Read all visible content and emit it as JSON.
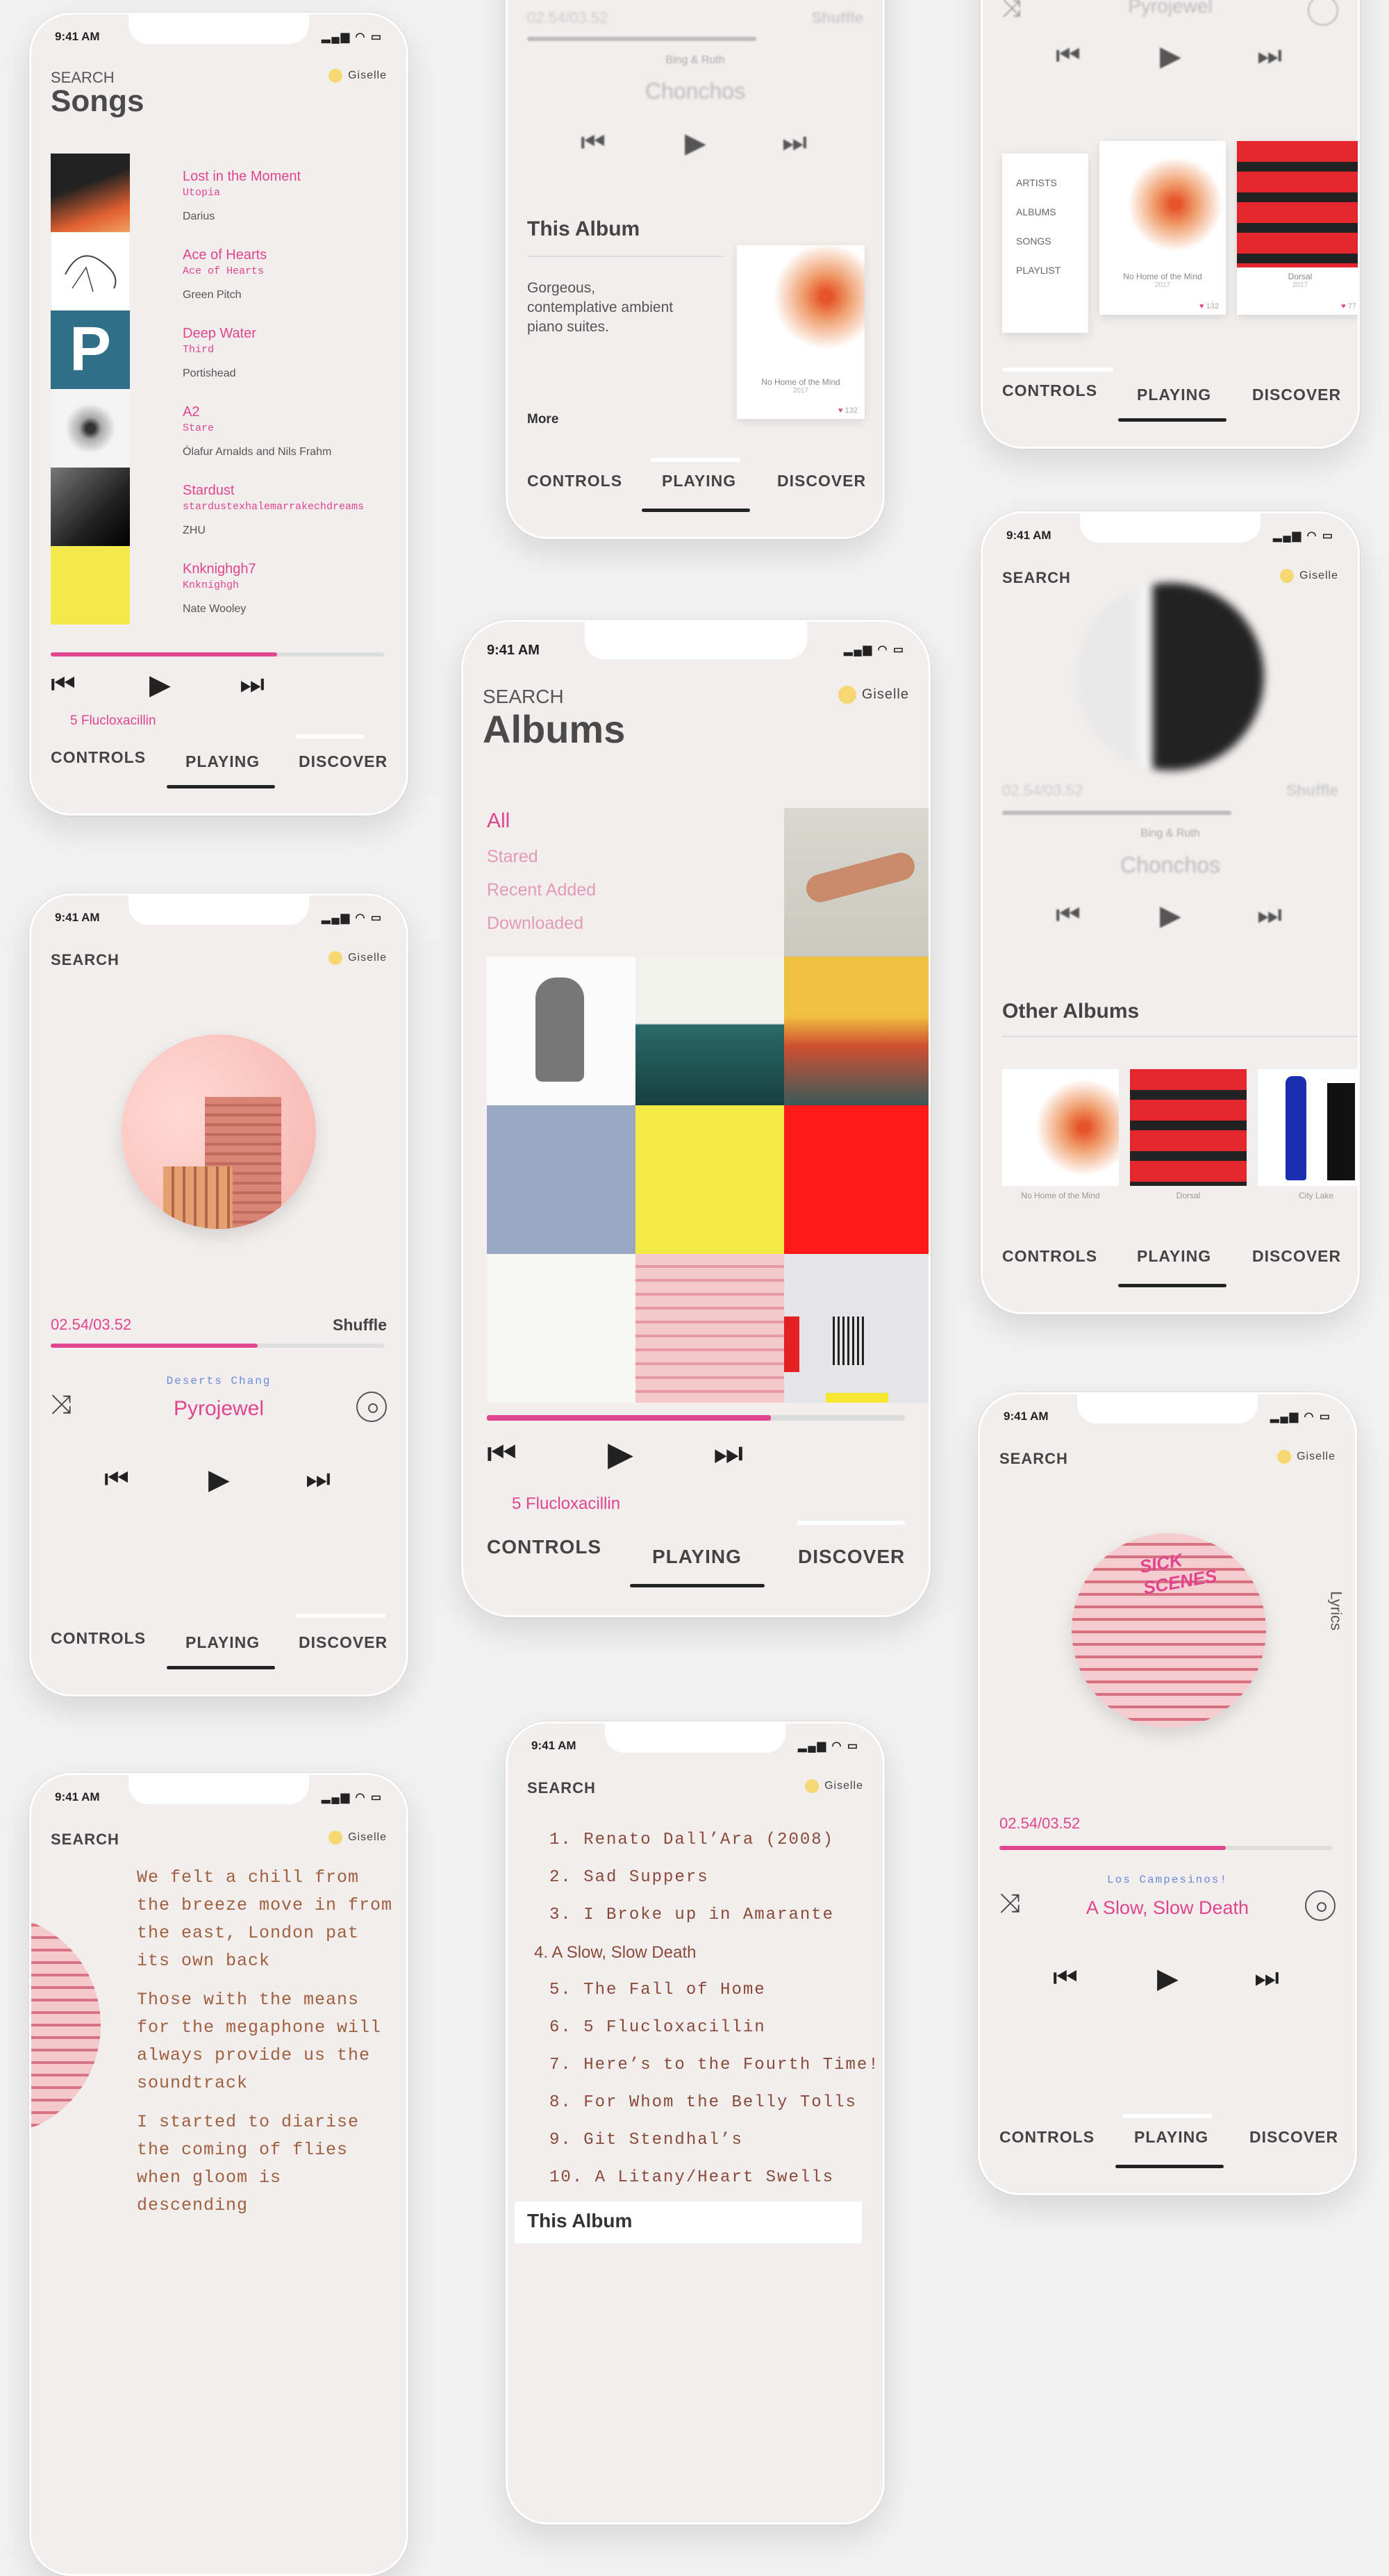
{
  "status": {
    "time": "9:41 AM",
    "signal": "▂▄▆ ◠ ▭"
  },
  "user": {
    "name": "Giselle"
  },
  "common": {
    "search": "SEARCH",
    "tabs": [
      "CONTROLS",
      "PLAYING",
      "DISCOVER"
    ]
  },
  "songs_screen": {
    "title": "Songs",
    "songs": [
      {
        "title": "Lost in the Moment",
        "album": "Utopia",
        "artist": "Darius"
      },
      {
        "title": "Ace of Hearts",
        "album": "Ace of Hearts",
        "artist": "Green Pitch"
      },
      {
        "title": "Deep Water",
        "album": "Third",
        "artist": "Portishead"
      },
      {
        "title": "A2",
        "album": "Stare",
        "artist": "Ólafur Arnalds and Nils Frahm"
      },
      {
        "title": "Stardust",
        "album": "stardustexhalemarrakechdreams",
        "artist": "ZHU"
      },
      {
        "title": "Knknighgh7",
        "album": "Knknighgh",
        "artist": "Nate Wooley"
      }
    ],
    "now_playing": "5 Flucloxacillin",
    "progress": 0.68
  },
  "album_detail": {
    "time": "02.54/03.52",
    "shuffle": "Shuffle",
    "artist": "Bing & Ruth",
    "song": "Chonchos",
    "section": "This Album",
    "description": "Gorgeous, contemplative ambient piano suites.",
    "more": "More",
    "album_name": "No Home of the Mind",
    "album_year": "2017",
    "likes": "132"
  },
  "menu_screen": {
    "song": "Pyrojewel",
    "menu": [
      "ARTISTS",
      "ALBUMS",
      "SONGS",
      "PLAYLIST"
    ],
    "cards": [
      {
        "name": "No Home of the Mind",
        "year": "2017",
        "likes": "132"
      },
      {
        "name": "Dorsal",
        "year": "2017",
        "likes": "77"
      }
    ]
  },
  "albums_screen": {
    "title": "Albums",
    "filters": [
      "All",
      "Stared",
      "Recent Added",
      "Downloaded"
    ],
    "now_playing": "5 Flucloxacillin",
    "progress": 0.68
  },
  "playing_blur": {
    "time": "02.54/03.52",
    "shuffle": "Shuffle",
    "artist": "Bing & Ruth",
    "song": "Chonchos",
    "section": "Other Albums",
    "albums": [
      "No Home of the Mind",
      "Dorsal",
      "City Lake"
    ]
  },
  "playing_pink": {
    "time": "02.54/03.52",
    "shuffle": "Shuffle",
    "artist": "Deserts Chang",
    "song": "Pyrojewel",
    "progress": 0.62
  },
  "lyrics_screen": {
    "paragraphs": [
      "We felt a chill from the breeze move in from the east, London pat its own back",
      "Those with the means for the megaphone will always provide us the soundtrack",
      "I started to diarise the coming of flies when gloom is descending"
    ]
  },
  "tracks_screen": {
    "tracks": [
      "1. Renato Dall’Ara (2008)",
      "2. Sad Suppers",
      "3. I Broke up in Amarante",
      "4. A Slow, Slow Death",
      "5. The Fall of Home",
      "6. 5 Flucloxacillin",
      "7. Here’s to the Fourth Time!",
      "8. For Whom the Belly Tolls",
      "9. Git Stendhal’s",
      "10. A Litany/Heart Swells"
    ],
    "active_index": 3,
    "section": "This Album"
  },
  "lyrics_player": {
    "time": "02.54/03.52",
    "artist": "Los Campesinos!",
    "song": "A Slow, Slow Death",
    "lyrics_label": "Lyrics",
    "progress": 0.68
  }
}
